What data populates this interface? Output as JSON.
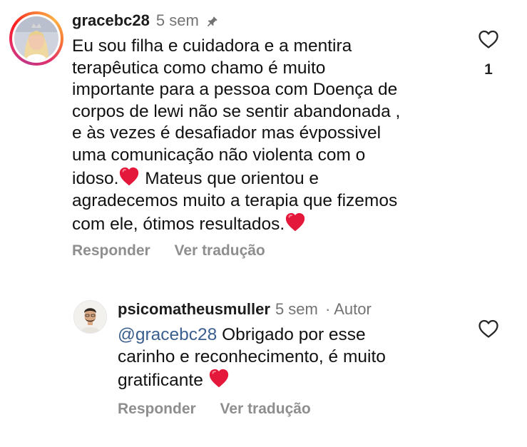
{
  "comment": {
    "username": "gracebc28",
    "time": "5 sem",
    "icon": "pin-icon",
    "lines": [
      "Eu sou filha e cuidadora e a mentira",
      "terapêutica como chamo é muito",
      "importante para a pessoa com Doença de",
      "corpos de lewi não se sentir abandonada ,",
      "e às vezes é desafiador mas évpossivel",
      "uma comunicação não violenta com o",
      "idoso.",
      " Mateus que orientou e",
      "agradecemos muito a terapia que fizemos",
      "com ele, ótimos resultados."
    ],
    "emoji": "❤️",
    "like_count": "1",
    "reply_label": "Responder",
    "translate_label": "Ver tradução"
  },
  "reply": {
    "username": "psicomatheusmuller",
    "time": "5 sem",
    "role": "· Autor",
    "mention": "@gracebc28",
    "lines": [
      " Obrigado por esse",
      "carinho e reconhecimento, é muito",
      "gratificante"
    ],
    "emoji": "❤️",
    "reply_label": "Responder",
    "translate_label": "Ver tradução"
  },
  "colors": {
    "heart_red": "#e4183a",
    "mention_blue": "#3a5f8f",
    "muted": "#8e8e8e"
  }
}
